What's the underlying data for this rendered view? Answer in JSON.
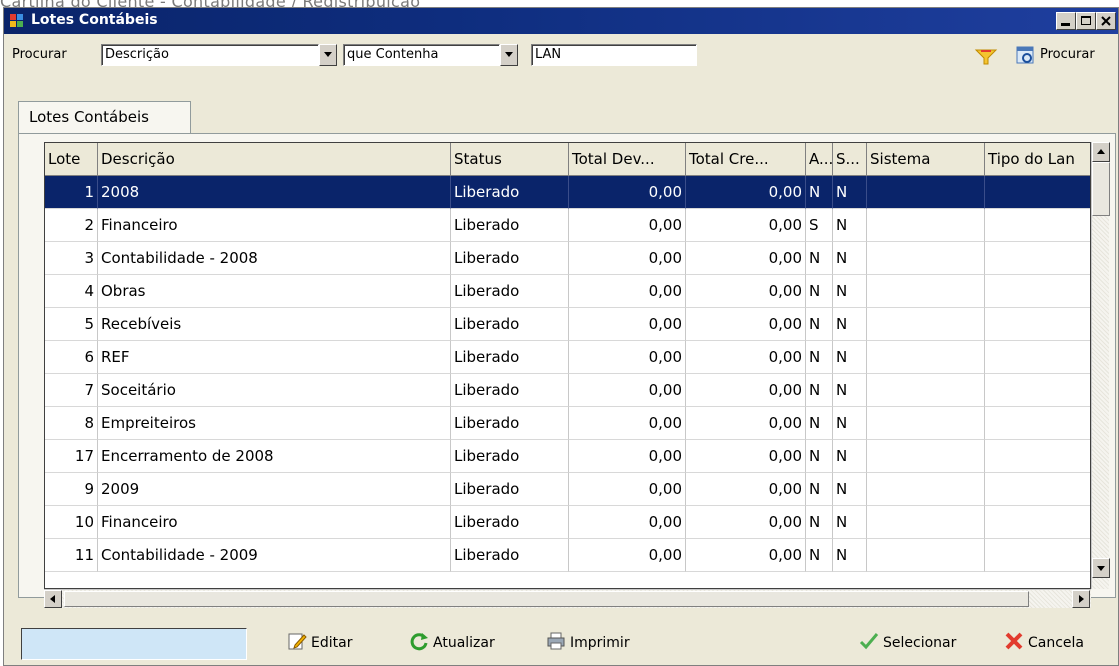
{
  "background_caption": "Cartilha do Cliente - Contabilidade / Redistribuição",
  "window": {
    "title": "Lotes Contábeis"
  },
  "search": {
    "label": "Procurar",
    "field_value": "Descrição",
    "condition_value": "que Contenha",
    "text_value": "LAN",
    "search_button_label": "Procurar"
  },
  "tab": {
    "label": "Lotes Contábeis"
  },
  "grid": {
    "columns": [
      "Lote",
      "Descrição",
      "Status",
      "Total Dev...",
      "Total Cre...",
      "A...",
      "S...",
      "Sistema",
      "Tipo do Lan"
    ],
    "rows": [
      {
        "lote": "1",
        "descricao": "2008",
        "status": "Liberado",
        "total_dev": "0,00",
        "total_cre": "0,00",
        "a": "N",
        "s": "N"
      },
      {
        "lote": "2",
        "descricao": "Financeiro",
        "status": "Liberado",
        "total_dev": "0,00",
        "total_cre": "0,00",
        "a": "S",
        "s": "N"
      },
      {
        "lote": "3",
        "descricao": "Contabilidade - 2008",
        "status": "Liberado",
        "total_dev": "0,00",
        "total_cre": "0,00",
        "a": "N",
        "s": "N"
      },
      {
        "lote": "4",
        "descricao": "Obras",
        "status": "Liberado",
        "total_dev": "0,00",
        "total_cre": "0,00",
        "a": "N",
        "s": "N"
      },
      {
        "lote": "5",
        "descricao": "Recebíveis",
        "status": "Liberado",
        "total_dev": "0,00",
        "total_cre": "0,00",
        "a": "N",
        "s": "N"
      },
      {
        "lote": "6",
        "descricao": "REF",
        "status": "Liberado",
        "total_dev": "0,00",
        "total_cre": "0,00",
        "a": "N",
        "s": "N"
      },
      {
        "lote": "7",
        "descricao": "Soceitário",
        "status": "Liberado",
        "total_dev": "0,00",
        "total_cre": "0,00",
        "a": "N",
        "s": "N"
      },
      {
        "lote": "8",
        "descricao": "Empreiteiros",
        "status": "Liberado",
        "total_dev": "0,00",
        "total_cre": "0,00",
        "a": "N",
        "s": "N"
      },
      {
        "lote": "17",
        "descricao": "Encerramento de 2008",
        "status": "Liberado",
        "total_dev": "0,00",
        "total_cre": "0,00",
        "a": "N",
        "s": "N"
      },
      {
        "lote": "9",
        "descricao": "2009",
        "status": "Liberado",
        "total_dev": "0,00",
        "total_cre": "0,00",
        "a": "N",
        "s": "N"
      },
      {
        "lote": "10",
        "descricao": "Financeiro",
        "status": "Liberado",
        "total_dev": "0,00",
        "total_cre": "0,00",
        "a": "N",
        "s": "N"
      },
      {
        "lote": "11",
        "descricao": "Contabilidade - 2009",
        "status": "Liberado",
        "total_dev": "0,00",
        "total_cre": "0,00",
        "a": "N",
        "s": "N"
      }
    ]
  },
  "bottom": {
    "editar": "Editar",
    "atualizar": "Atualizar",
    "imprimir": "Imprimir",
    "selecionar": "Selecionar",
    "cancela": "Cancela"
  },
  "colors": {
    "titlebar": "#0a246a",
    "selection": "#0a246a",
    "window_bg": "#ece9d8",
    "quick_input_bg": "#cfe6f7"
  }
}
